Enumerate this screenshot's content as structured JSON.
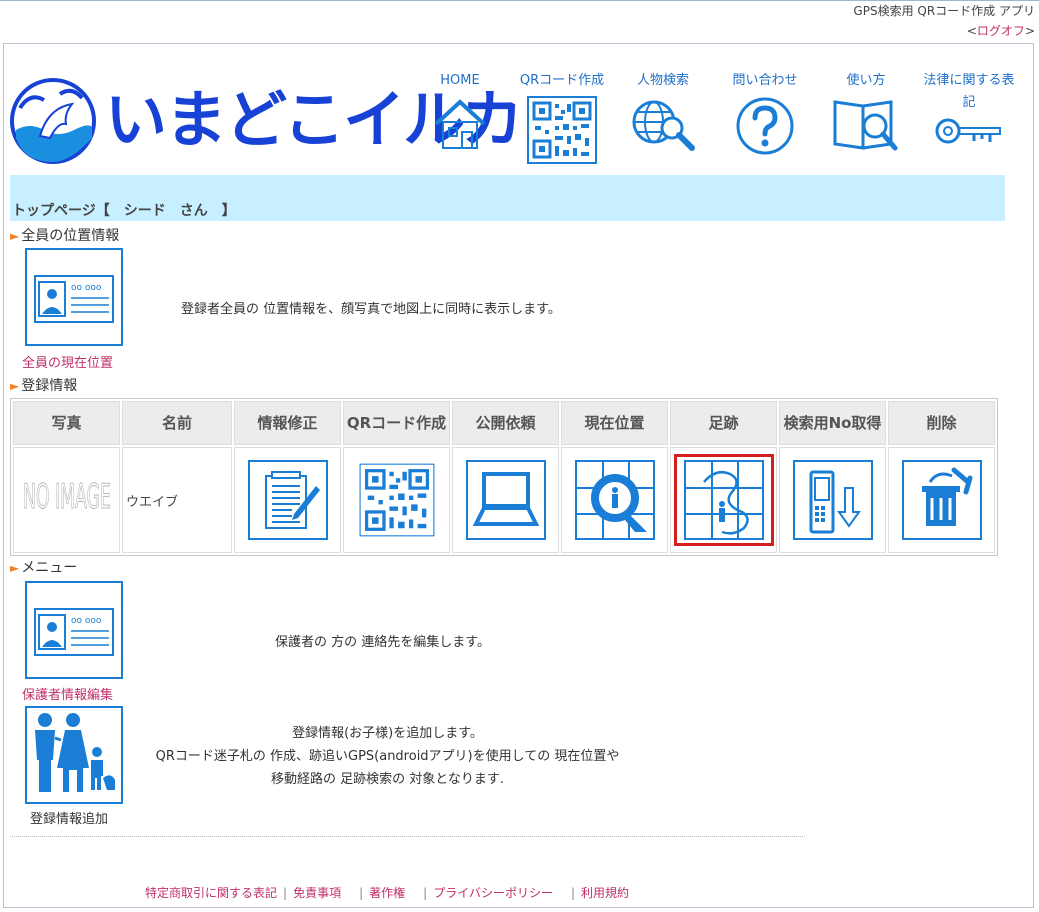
{
  "top_links": {
    "line1": "GPS検索用 QRコード作成 アプリ",
    "logoff_open": "<",
    "logoff": "ログオフ",
    "logoff_close": ">"
  },
  "logo": {
    "text": "いまどこイルカ"
  },
  "nav": [
    {
      "label": "HOME",
      "icon": "home-icon"
    },
    {
      "label": "QRコード作成",
      "icon": "qr-code-icon"
    },
    {
      "label": "人物検索",
      "icon": "globe-search-icon"
    },
    {
      "label": "問い合わせ",
      "icon": "question-icon"
    },
    {
      "label": "使い方",
      "icon": "book-search-icon"
    },
    {
      "label": "法律に関する表記",
      "icon": "key-icon"
    }
  ],
  "banner": {
    "title": "トップページ【　シード　さん　】"
  },
  "sections": {
    "all_position": "全員の位置情報",
    "registration": "登録情報",
    "menu": "メニュー"
  },
  "all_position": {
    "caption": "全員の現在位置",
    "desc": "登録者全員の 位置情報を、顔写真で地図上に同時に表示します。"
  },
  "table": {
    "headers": [
      "写真",
      "名前",
      "情報修正",
      "QRコード作成",
      "公開依頼",
      "現在位置",
      "足跡",
      "検索用No取得",
      "削除"
    ],
    "row": {
      "photo": "NO IMAGE",
      "name": "ウエイブ"
    }
  },
  "menu": {
    "guardian_caption": "保護者情報編集",
    "guardian_desc": "保護者の 方の 連絡先を編集します。",
    "add_caption": "登録情報追加",
    "add_desc": [
      "登録情報(お子様)を追加します。",
      "QRコード迷子札の 作成、跡追いGPS(androidアプリ)を使用しての 現在位置や",
      "移動経路の 足跡検索の 対象となります."
    ]
  },
  "footer": [
    "特定商取引に関する表記",
    "免責事項",
    "著作権",
    "プライバシーポリシー",
    "利用規約"
  ],
  "colors": {
    "accent": "#1b7ed6",
    "link": "#c0306b",
    "banner": "#c8efff",
    "logo": "#1842d6",
    "highlight": "#d41e1e"
  }
}
